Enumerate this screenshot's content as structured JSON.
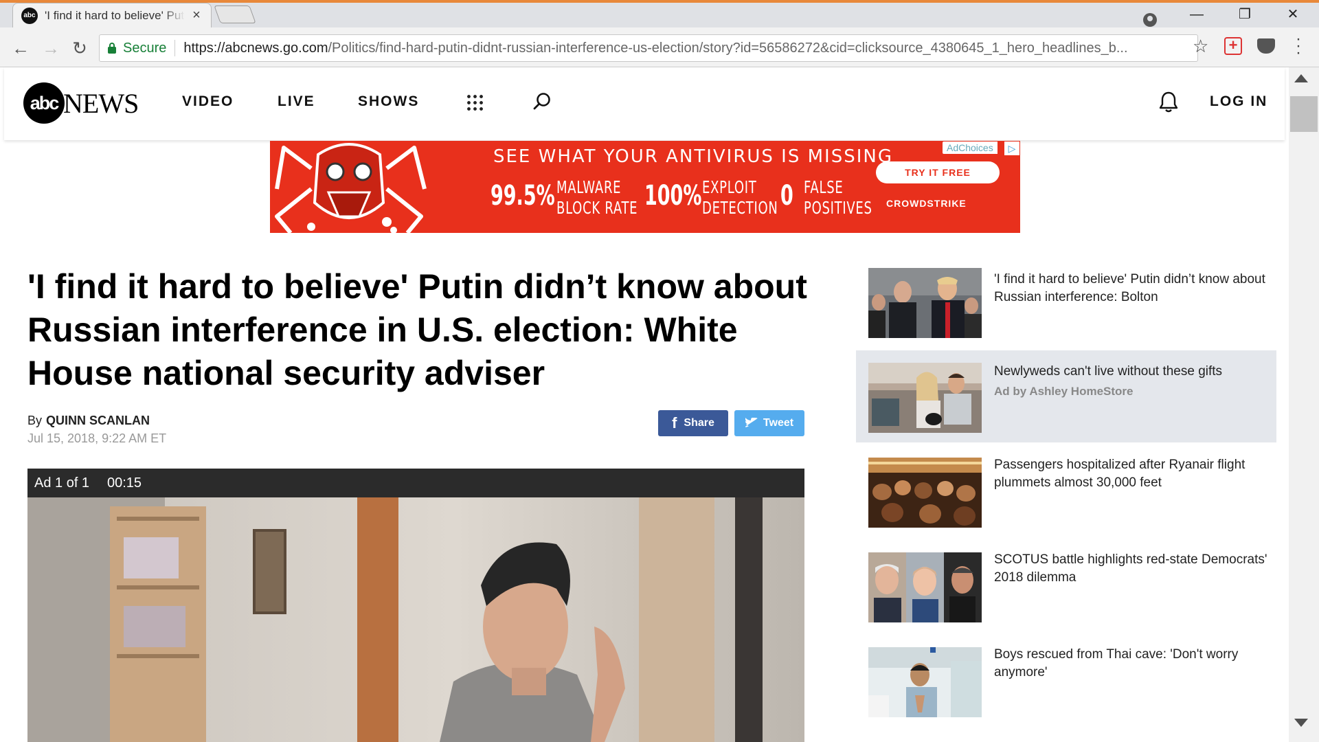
{
  "browser": {
    "tab_title": "'I find it hard to believe' Putin didn't know about Russian interference",
    "tab_close": "×",
    "favicon_text": "abc",
    "secure_label": "Secure",
    "url_host": "https://abcnews.go.com",
    "url_path": "/Politics/find-hard-putin-didnt-russian-interference-us-election/story?id=56586272&cid=clicksource_4380645_1_hero_headlines_b...",
    "window_min": "—",
    "window_max": "❐",
    "window_close": "✕",
    "back": "←",
    "forward": "→",
    "reload": "↻",
    "star": "☆",
    "menu": "⋮"
  },
  "site": {
    "logo_abc": "abc",
    "logo_news": "NEWS",
    "nav": {
      "video": "VIDEO",
      "live": "LIVE",
      "shows": "SHOWS"
    },
    "login": "LOG IN"
  },
  "ad_banner": {
    "adchoices": "AdChoices",
    "adchoices_icon": "▷",
    "headline": "SEE WHAT YOUR ANTIVIRUS IS MISSING",
    "stats": [
      {
        "value": "99.5%",
        "line1": "MALWARE",
        "line2": "BLOCK RATE"
      },
      {
        "value": "100%",
        "line1": "EXPLOIT",
        "line2": "DETECTION"
      },
      {
        "value": "0",
        "line1": "FALSE",
        "line2": "POSITIVES"
      }
    ],
    "cta": "TRY IT FREE",
    "brand": "CROWDSTRIKE",
    "color": "#e8301c"
  },
  "article": {
    "headline": "'I find it hard to believe' Putin didn’t know about Russian interference in U.S. election: White House national security adviser",
    "byline_prefix": "By",
    "author": "QUINN SCANLAN",
    "date": "Jul 15, 2018, 9:22 AM ET",
    "share_label": "Share",
    "facebook_glyph": "f",
    "tweet_label": "Tweet"
  },
  "video_player": {
    "ad_count": "Ad 1 of 1",
    "ad_timer": "00:15"
  },
  "sidebar": {
    "items": [
      {
        "title": "'I find it hard to believe' Putin didn’t know about Russian interference: Bolton",
        "sponsor": ""
      },
      {
        "title": "Newlyweds can't live without these gifts",
        "sponsor": "Ad by Ashley HomeStore"
      },
      {
        "title": "Passengers hospitalized after Ryanair flight plummets almost 30,000 feet",
        "sponsor": ""
      },
      {
        "title": "SCOTUS battle highlights red-state Democrats' 2018 dilemma",
        "sponsor": ""
      },
      {
        "title": "Boys rescued from Thai cave: 'Don't worry anymore'",
        "sponsor": ""
      }
    ]
  },
  "colors": {
    "facebook": "#3b5998",
    "twitter": "#55acee",
    "secure_green": "#188038"
  }
}
